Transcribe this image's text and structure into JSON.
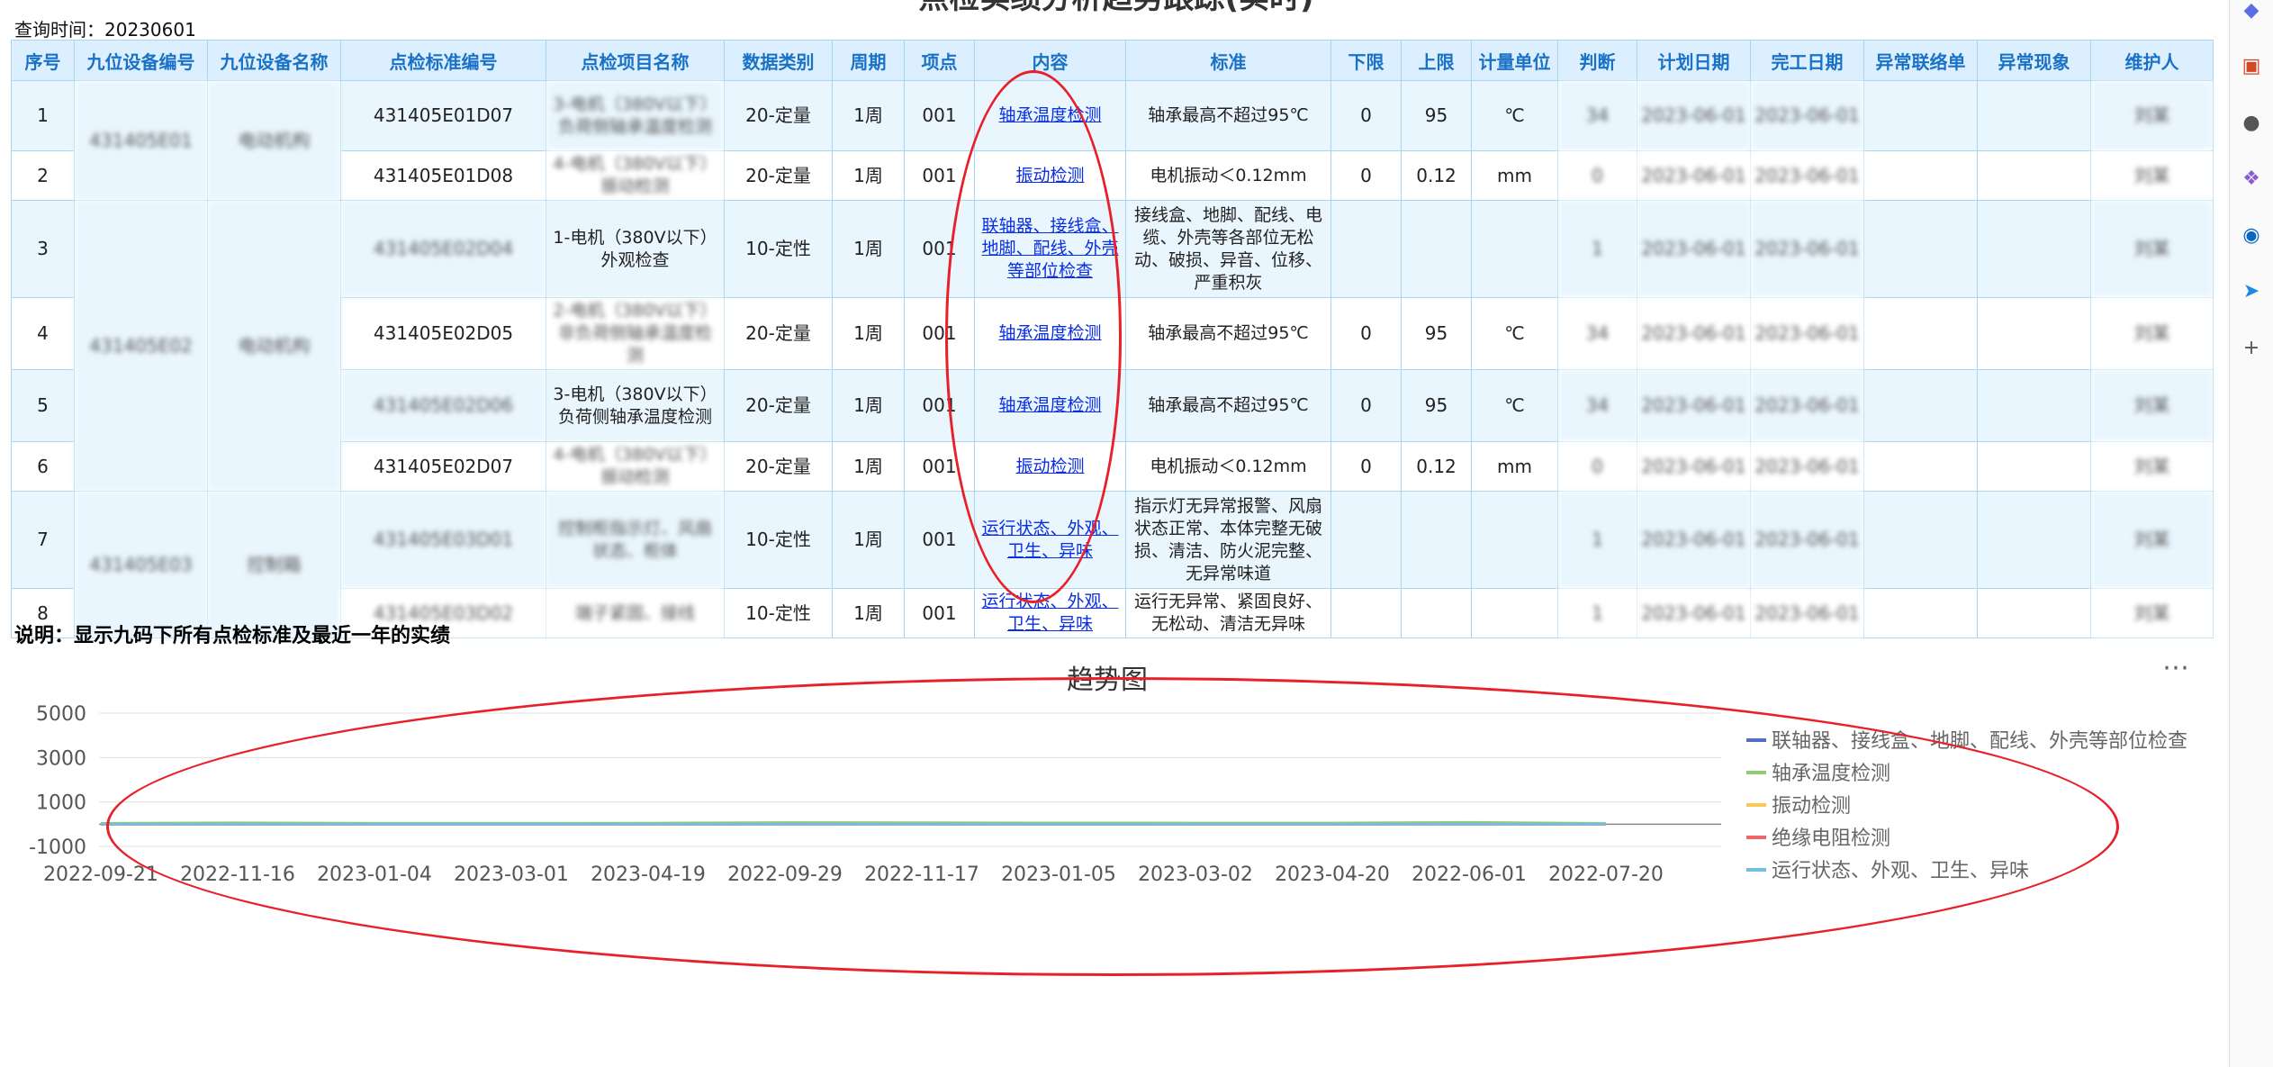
{
  "page": {
    "title": "点检实绩分析趋势跟踪(实时)",
    "query_time": "查询时间：20230601"
  },
  "table": {
    "headers": [
      "序号",
      "九位设备编号",
      "九位设备名称",
      "点检标准编号",
      "点检项目名称",
      "数据类别",
      "周期",
      "项点",
      "内容",
      "标准",
      "下限",
      "上限",
      "计量单位",
      "判断",
      "计划日期",
      "完工日期",
      "异常联络单",
      "异常现象",
      "维护人"
    ],
    "groups": [
      {
        "code": "431405E01",
        "name": "电动机构"
      },
      {
        "code": "431405E02",
        "name": "电动机构"
      },
      {
        "code": "431405E03",
        "name": "控制箱"
      }
    ],
    "rows": [
      {
        "no": "1",
        "std_no": "431405E01D07",
        "item": "3-电机（380V以下）负荷侧轴承温度检测",
        "type": "20-定量",
        "cycle": "1周",
        "point": "001",
        "content": "轴承温度检测",
        "standard": "轴承最高不超过95℃",
        "lower": "0",
        "upper": "95",
        "unit": "℃",
        "judge": "34",
        "plan_date": "2023-06-01",
        "done_date": "2023-06-01",
        "abn_contact": "",
        "abn_phen": "",
        "maintainer": "刘某"
      },
      {
        "no": "2",
        "std_no": "431405E01D08",
        "item": "4-电机（380V以下）振动检测",
        "type": "20-定量",
        "cycle": "1周",
        "point": "001",
        "content": "振动检测",
        "standard": "电机振动＜0.12mm",
        "lower": "0",
        "upper": "0.12",
        "unit": "mm",
        "judge": "0",
        "plan_date": "2023-06-01",
        "done_date": "2023-06-01",
        "abn_contact": "",
        "abn_phen": "",
        "maintainer": "刘某"
      },
      {
        "no": "3",
        "std_no": "431405E02D04",
        "item": "1-电机（380V以下）外观检查",
        "type": "10-定性",
        "cycle": "1周",
        "point": "001",
        "content": "联轴器、接线盒、地脚、配线、外壳等部位检查",
        "standard": "接线盒、地脚、配线、电缆、外壳等各部位无松动、破损、异音、位移、严重积灰",
        "lower": "",
        "upper": "",
        "unit": "",
        "judge": "1",
        "plan_date": "2023-06-01",
        "done_date": "2023-06-01",
        "abn_contact": "",
        "abn_phen": "",
        "maintainer": "刘某"
      },
      {
        "no": "4",
        "std_no": "431405E02D05",
        "item": "2-电机（380V以下）非负荷侧轴承温度检测",
        "type": "20-定量",
        "cycle": "1周",
        "point": "001",
        "content": "轴承温度检测",
        "standard": "轴承最高不超过95℃",
        "lower": "0",
        "upper": "95",
        "unit": "℃",
        "judge": "34",
        "plan_date": "2023-06-01",
        "done_date": "2023-06-01",
        "abn_contact": "",
        "abn_phen": "",
        "maintainer": "刘某"
      },
      {
        "no": "5",
        "std_no": "431405E02D06",
        "item": "3-电机（380V以下）负荷侧轴承温度检测",
        "type": "20-定量",
        "cycle": "1周",
        "point": "001",
        "content": "轴承温度检测",
        "standard": "轴承最高不超过95℃",
        "lower": "0",
        "upper": "95",
        "unit": "℃",
        "judge": "34",
        "plan_date": "2023-06-01",
        "done_date": "2023-06-01",
        "abn_contact": "",
        "abn_phen": "",
        "maintainer": "刘某"
      },
      {
        "no": "6",
        "std_no": "431405E02D07",
        "item": "4-电机（380V以下）振动检测",
        "type": "20-定量",
        "cycle": "1周",
        "point": "001",
        "content": "振动检测",
        "standard": "电机振动＜0.12mm",
        "lower": "0",
        "upper": "0.12",
        "unit": "mm",
        "judge": "0",
        "plan_date": "2023-06-01",
        "done_date": "2023-06-01",
        "abn_contact": "",
        "abn_phen": "",
        "maintainer": "刘某"
      },
      {
        "no": "7",
        "std_no": "431405E03D01",
        "item": "控制柜指示灯、风扇状态、柜体",
        "type": "10-定性",
        "cycle": "1周",
        "point": "001",
        "content": "运行状态、外观、卫生、异味",
        "standard": "指示灯无异常报警、风扇状态正常、本体完整无破损、清洁、防火泥完整、无异常味道",
        "lower": "",
        "upper": "",
        "unit": "",
        "judge": "1",
        "plan_date": "2023-06-01",
        "done_date": "2023-06-01",
        "abn_contact": "",
        "abn_phen": "",
        "maintainer": "刘某"
      },
      {
        "no": "8",
        "std_no": "431405E03D02",
        "item": "端子紧固、接线",
        "type": "10-定性",
        "cycle": "1周",
        "point": "001",
        "content": "运行状态、外观、卫生、异味",
        "standard": "运行无异常、紧固良好、无松动、清洁无异味",
        "lower": "",
        "upper": "",
        "unit": "",
        "judge": "1",
        "plan_date": "2023-06-01",
        "done_date": "2023-06-01",
        "abn_contact": "",
        "abn_phen": "",
        "maintainer": "刘某"
      }
    ]
  },
  "note": "说明：显示九码下所有点检标准及最近一年的实绩",
  "chart_title": "趋势图",
  "more_icon": "ellipsis-icon",
  "chart_data": {
    "type": "line",
    "title": "趋势图",
    "y_ticks": [
      "5000",
      "3000",
      "1000",
      "-1000"
    ],
    "ylim": [
      -1000,
      5000
    ],
    "x_labels": [
      "2022-09-21",
      "2022-11-16",
      "2023-01-04",
      "2023-03-01",
      "2023-04-19",
      "2022-09-29",
      "2022-11-17",
      "2023-01-05",
      "2023-03-02",
      "2023-04-20",
      "2022-06-01",
      "2022-07-20"
    ],
    "legend_position": "right",
    "series": [
      {
        "name": "联轴器、接线盒、地脚、配线、外壳等部位检查",
        "color": "#5470c6",
        "values": [
          1,
          1,
          1,
          1,
          1,
          1,
          1,
          1,
          1,
          1,
          1,
          1
        ]
      },
      {
        "name": "轴承温度检测",
        "color": "#91cc75",
        "values": [
          34,
          60,
          40,
          38,
          45,
          70,
          62,
          55,
          50,
          48,
          80,
          30
        ]
      },
      {
        "name": "振动检测",
        "color": "#fac858",
        "values": [
          0,
          0,
          0,
          0,
          0,
          0,
          0,
          0,
          0,
          0,
          0,
          0
        ]
      },
      {
        "name": "绝缘电阻检测",
        "color": "#ee6666",
        "values": [
          0,
          0,
          0,
          0,
          0,
          0,
          0,
          0,
          0,
          0,
          0,
          0
        ]
      },
      {
        "name": "运行状态、外观、卫生、异味",
        "color": "#73c0de",
        "values": [
          1,
          1,
          1,
          1,
          1,
          1,
          1,
          1,
          1,
          1,
          1,
          1
        ]
      }
    ]
  },
  "right_sidebar": {
    "icons": [
      "diamond-icon",
      "briefcase-icon",
      "person-icon",
      "copilot-icon",
      "outlook-icon",
      "send-icon",
      "plus-icon"
    ]
  },
  "annotation_colors": {
    "ellipse": "#e8202a"
  }
}
